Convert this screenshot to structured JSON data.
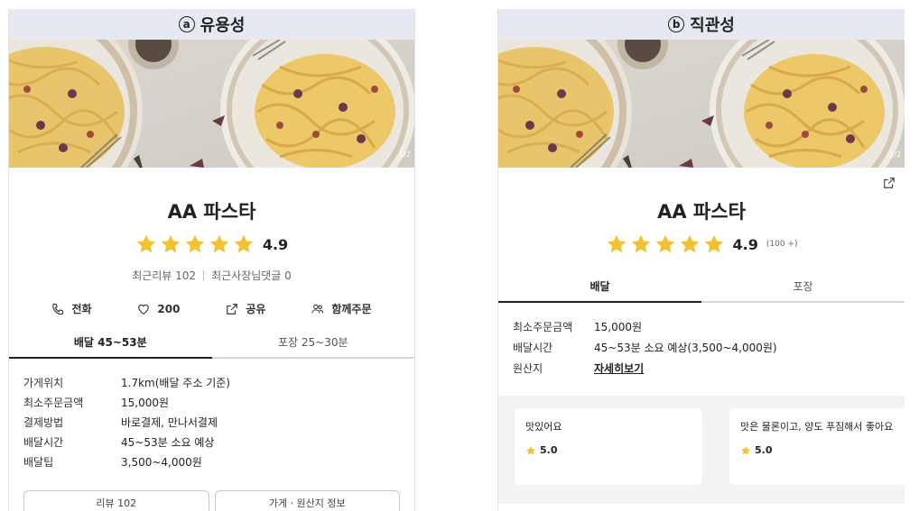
{
  "colors": {
    "header_bg": "#e6e8f2",
    "star": "#f2c233",
    "tab_active": "#222222"
  },
  "panel_a": {
    "letter": "ⓐ",
    "title": "유용성",
    "page_indicator": "1/2",
    "store_name": "AA 파스타",
    "rating": "4.9",
    "recent_reviews": "최근리뷰 102",
    "owner_comments": "최근사장님댓글 0",
    "actions": [
      {
        "icon": "phone-icon",
        "label": "전화"
      },
      {
        "icon": "heart-icon",
        "label": "200"
      },
      {
        "icon": "share-icon",
        "label": "공유"
      },
      {
        "icon": "group-icon",
        "label": "함께주문"
      }
    ],
    "tabs": [
      {
        "label": "배달 45~53분",
        "active": true
      },
      {
        "label": "포장 25~30분",
        "active": false
      }
    ],
    "info": [
      {
        "key": "가게위치",
        "value": "1.7km(배달 주소 기준)"
      },
      {
        "key": "최소주문금액",
        "value": "15,000원"
      },
      {
        "key": "결제방법",
        "value": "바로결제, 만나서결제"
      },
      {
        "key": "배달시간",
        "value": "45~53분 소요 예상"
      },
      {
        "key": "배달팁",
        "value": "3,500~4,000원"
      }
    ],
    "buttons": {
      "reviews": "리뷰 102",
      "store_info": "가게 · 원산지 정보"
    }
  },
  "panel_b": {
    "letter": "ⓑ",
    "title": "직관성",
    "page_indicator": "1/2",
    "store_name": "AA 파스타",
    "rating": "4.9",
    "rating_count": "(100 +)",
    "tabs": [
      {
        "label": "배달",
        "active": true
      },
      {
        "label": "포장",
        "active": false
      }
    ],
    "info": [
      {
        "key": "최소주문금액",
        "value": "15,000원"
      },
      {
        "key": "배달시간",
        "value": "45~53분 소요 예상(3,500~4,000원)"
      },
      {
        "key": "원산지",
        "value": "자세히보기"
      }
    ],
    "reviews": [
      {
        "text": "맛있어요",
        "score": "5.0"
      },
      {
        "text": "맛은 물론이고, 양도 푸짐해서 좋아요",
        "score": "5.0"
      }
    ]
  }
}
